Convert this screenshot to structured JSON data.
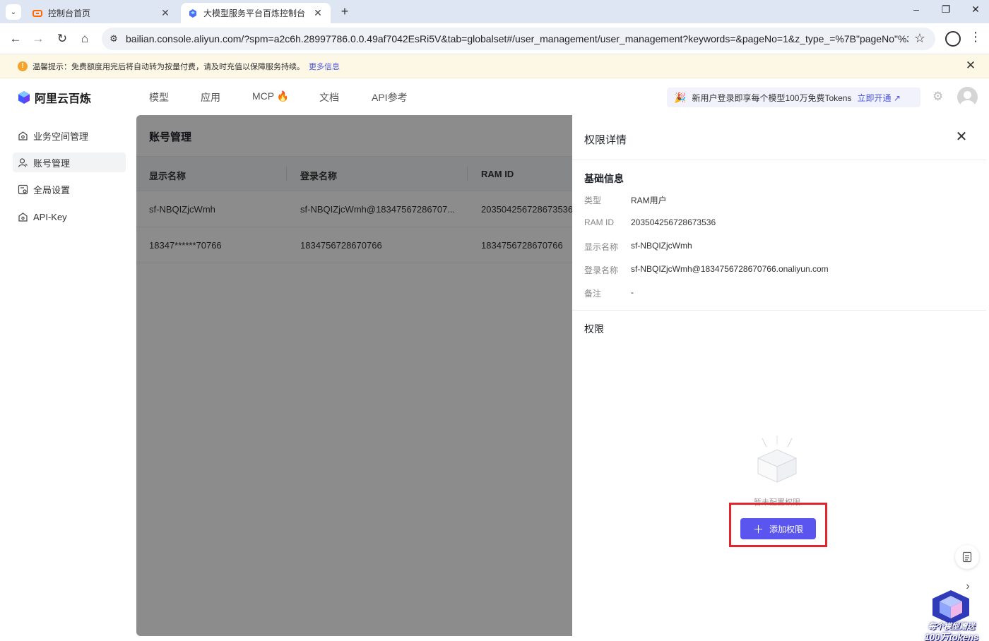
{
  "browser": {
    "tabs": [
      {
        "title": "控制台首页",
        "active": false
      },
      {
        "title": "大模型服务平台百炼控制台",
        "active": true
      }
    ],
    "new_tab": "+",
    "url": "bailian.console.aliyun.com/?spm=a2c6h.28997786.0.0.49af7042EsRi5V&tab=globalset#/user_management/user_management?keywords=&pageNo=1&z_type_=%7B\"pageNo\"%3...",
    "window_controls": {
      "minimize": "–",
      "restore": "❐",
      "close": "✕"
    }
  },
  "notice": {
    "text": "温馨提示：免费额度用完后将自动转为按量付费，请及时充值以保障服务持续。",
    "link": "更多信息",
    "close": "✕"
  },
  "header": {
    "logo": "阿里云百炼",
    "nav": [
      "模型",
      "应用",
      "MCP",
      "文档",
      "API参考"
    ],
    "promo_text": "新用户登录即享每个模型100万免费Tokens",
    "promo_link": "立即开通",
    "accent": "#5b55f0"
  },
  "sidebar": {
    "items": [
      {
        "label": "业务空间管理",
        "icon": "workspace-icon",
        "active": false
      },
      {
        "label": "账号管理",
        "icon": "user-icon",
        "active": true
      },
      {
        "label": "全局设置",
        "icon": "settings-icon",
        "active": false
      },
      {
        "label": "API-Key",
        "icon": "key-icon",
        "active": false
      }
    ]
  },
  "main": {
    "title": "账号管理",
    "columns": [
      "显示名称",
      "登录名称",
      "RAM ID"
    ],
    "rows": [
      [
        "sf-NBQIZjcWmh",
        "sf-NBQIZjcWmh@18347567286707...",
        "203504256728673536"
      ],
      [
        "18347******70766",
        "1834756728670766",
        "1834756728670766"
      ]
    ]
  },
  "drawer": {
    "title": "权限详情",
    "basic_title": "基础信息",
    "fields": [
      {
        "label": "类型",
        "value": "RAM用户"
      },
      {
        "label": "RAM ID",
        "value": "203504256728673536"
      },
      {
        "label": "显示名称",
        "value": "sf-NBQIZjcWmh"
      },
      {
        "label": "登录名称",
        "value": "sf-NBQIZjcWmh@1834756728670766.onaliyun.com"
      },
      {
        "label": "备注",
        "value": "-"
      }
    ],
    "permission_title": "权限",
    "empty_text": "暂未配置权限",
    "add_button": "添加权限",
    "highlight_color": "#e2262c"
  },
  "float": {
    "badge_line1": "每个模型赠送",
    "badge_line2": "100万tokens"
  }
}
